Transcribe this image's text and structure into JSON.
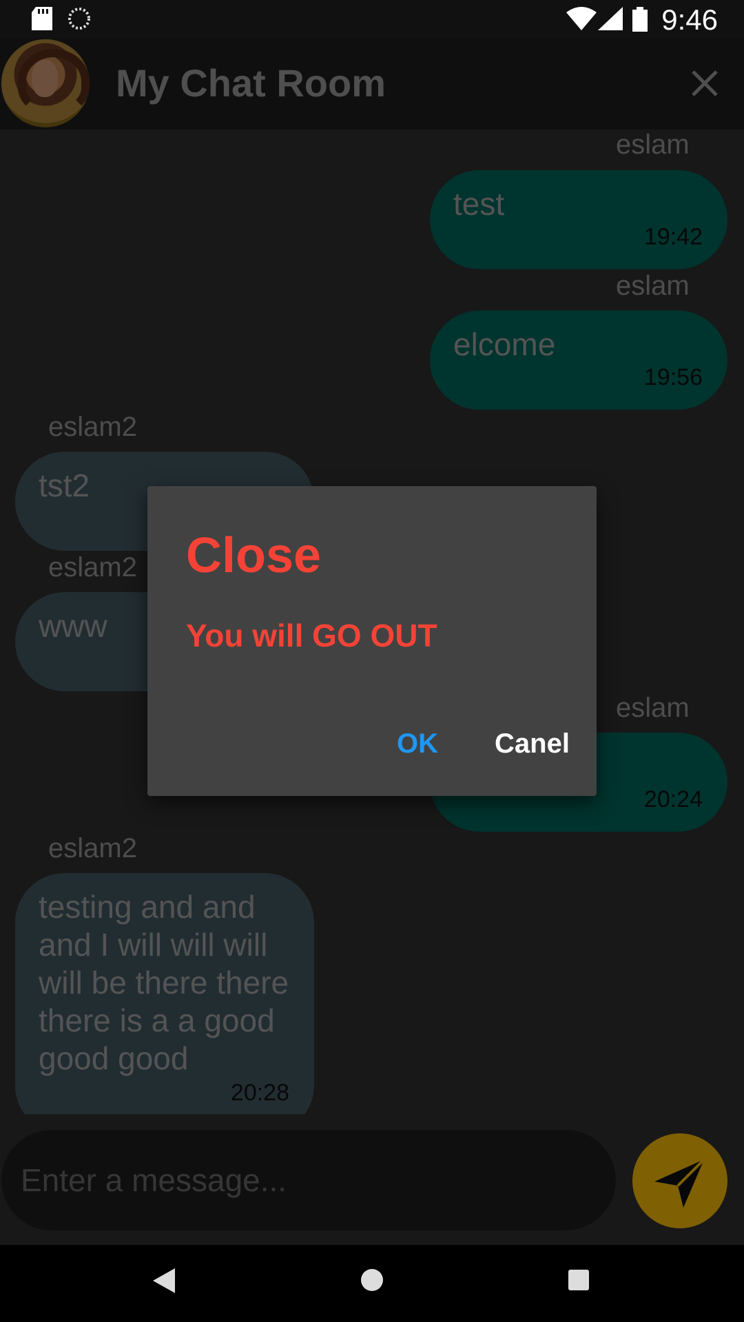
{
  "status_bar": {
    "time": "9:46"
  },
  "app_bar": {
    "title": "My Chat Room"
  },
  "messages": [
    {
      "sender": "eslam",
      "text": "test",
      "time": "19:42",
      "side": "me"
    },
    {
      "sender": "eslam",
      "text": "elcome",
      "time": "19:56",
      "side": "me"
    },
    {
      "sender": "eslam2",
      "text": "tst2",
      "time": "",
      "side": "them"
    },
    {
      "sender": "eslam2",
      "text": "www",
      "time": "",
      "side": "them"
    },
    {
      "sender": "eslam",
      "text": "",
      "time": "20:24",
      "side": "me"
    },
    {
      "sender": "eslam2",
      "text": "testing and and and I will will will will be there there there is a a good good good",
      "time": "20:28",
      "side": "them"
    }
  ],
  "composer": {
    "placeholder": "Enter a message..."
  },
  "dialog": {
    "title": "Close",
    "message": "You will GO OUT",
    "ok_label": "OK",
    "cancel_label": "Canel"
  },
  "colors": {
    "accent": "#ffc107",
    "my_bubble": "#00695c",
    "their_bubble": "#455a64",
    "dialog_text": "#f44336",
    "ok_button": "#2196f3"
  }
}
